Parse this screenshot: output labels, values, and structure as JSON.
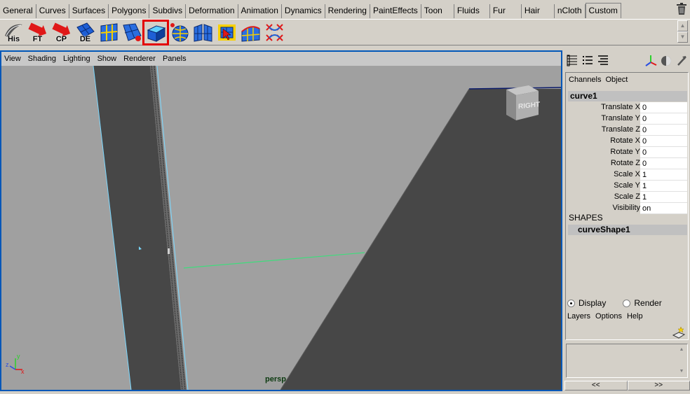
{
  "shelf": {
    "tabs": [
      "General",
      "Curves",
      "Surfaces",
      "Polygons",
      "Subdivs",
      "Deformation",
      "Animation",
      "Dynamics",
      "Rendering",
      "PaintEffects",
      "Toon",
      "Fluids",
      "Fur",
      "Hair",
      "nCloth",
      "Custom"
    ],
    "active_tab": "Custom",
    "buttons": [
      {
        "name": "history-button",
        "label": "His"
      },
      {
        "name": "freeze-transformations-button",
        "label": "FT"
      },
      {
        "name": "center-pivot-button",
        "label": "CP"
      },
      {
        "name": "delete-edge-button",
        "label": "DE"
      },
      {
        "name": "subdiv-edit-button",
        "label": ""
      },
      {
        "name": "subdiv-proxy-button",
        "label": ""
      },
      {
        "name": "subdiv-extrude-button",
        "label": ""
      },
      {
        "name": "subdiv-sphere-button",
        "label": ""
      },
      {
        "name": "subdiv-mirror-button",
        "label": ""
      },
      {
        "name": "subdiv-select-button",
        "label": ""
      },
      {
        "name": "subdiv-plane-button",
        "label": ""
      },
      {
        "name": "subdiv-collapse-button",
        "label": ""
      }
    ],
    "highlighted_button": "subdiv-extrude-button",
    "highlight_color": "#e30000"
  },
  "viewport": {
    "menu": [
      "View",
      "Shading",
      "Lighting",
      "Show",
      "Renderer",
      "Panels"
    ],
    "camera_label": "persp",
    "view_cube_label": "RIGHT",
    "axis_labels": {
      "y": "y",
      "z": "z",
      "x": "x"
    },
    "border_color": "#0057b8",
    "background_color": "#a0a0a0",
    "surface_color": "#474747",
    "curve_color": "#3fdc7c"
  },
  "channel_box": {
    "menu": [
      "Channels",
      "Object"
    ],
    "object_name": "curve1",
    "attributes": [
      {
        "name": "Translate X",
        "value": "0"
      },
      {
        "name": "Translate Y",
        "value": "0"
      },
      {
        "name": "Translate Z",
        "value": "0"
      },
      {
        "name": "Rotate X",
        "value": "0"
      },
      {
        "name": "Rotate Y",
        "value": "0"
      },
      {
        "name": "Rotate Z",
        "value": "0"
      },
      {
        "name": "Scale X",
        "value": "1"
      },
      {
        "name": "Scale Y",
        "value": "1"
      },
      {
        "name": "Scale Z",
        "value": "1"
      },
      {
        "name": "Visibility",
        "value": "on"
      }
    ],
    "shapes_header": "SHAPES",
    "shape_name": "curveShape1"
  },
  "layer_editor": {
    "modes": [
      "Display",
      "Render"
    ],
    "selected_mode": "Display",
    "menu": [
      "Layers",
      "Options",
      "Help"
    ],
    "nav_prev": "<<",
    "nav_next": ">>"
  }
}
